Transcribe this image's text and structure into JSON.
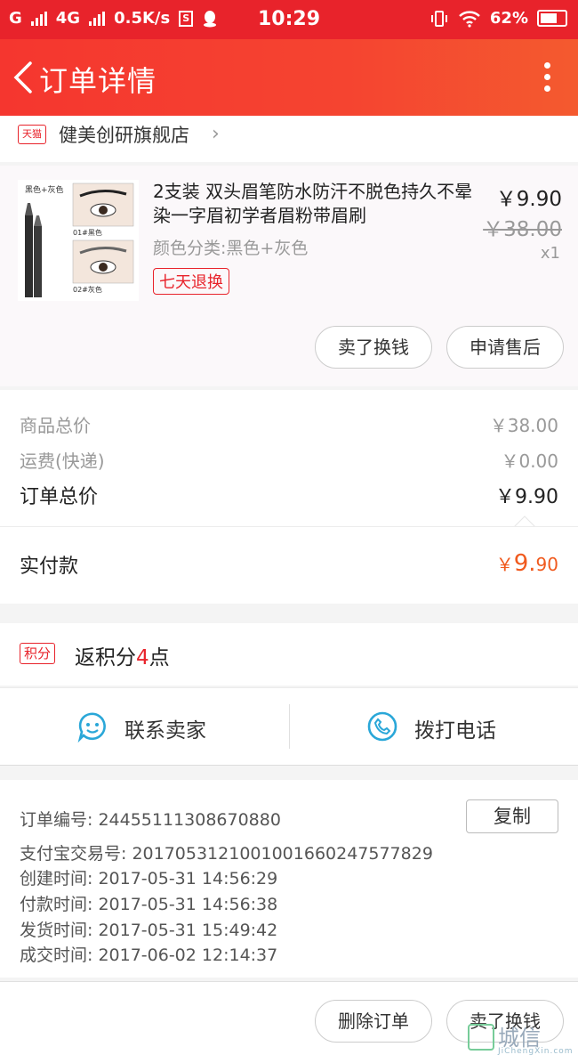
{
  "status_bar": {
    "carrier1": "G",
    "carrier2": "4G",
    "speed": "0.5K/s",
    "s_badge": "S",
    "time": "10:29",
    "battery": "62%"
  },
  "header": {
    "title": "订单详情"
  },
  "shop": {
    "badge": "天猫",
    "name": "健美创研旗舰店"
  },
  "product": {
    "title": "2支装 双头眉笔防水防汗不脱色持久不晕染一字眉初学者眉粉带眉刷",
    "attribute": "颜色分类:黑色+灰色",
    "tag": "七天退换",
    "price": "￥9.90",
    "original_price": "￥38.00",
    "quantity": "x1",
    "thumb_caption": "黑色+灰色",
    "thumb_label_1": "01#黑色",
    "thumb_label_2": "02#灰色"
  },
  "product_actions": {
    "sell": "卖了换钱",
    "after_sale": "申请售后"
  },
  "summary": {
    "goods_total_label": "商品总价",
    "goods_total": "￥38.00",
    "shipping_label": "运费(快递)",
    "shipping": "￥0.00",
    "order_total_label": "订单总价",
    "order_total": "￥9.90",
    "paid_label": "实付款",
    "paid_currency": "￥",
    "paid_int": "9.",
    "paid_dec": "90"
  },
  "points": {
    "badge": "积分",
    "text_before": "返积分",
    "num": "4",
    "text_after": "点"
  },
  "contact": {
    "seller": "联系卖家",
    "phone": "拨打电话"
  },
  "order_info": {
    "order_no": "订单编号:   24455111308670880",
    "copy": "复制",
    "alipay_no": "支付宝交易号:   2017053121001001660247577829",
    "created": "创建时间:   2017-05-31 14:56:29",
    "paid": "付款时间:   2017-05-31 14:56:38",
    "shipped": "发货时间:   2017-05-31 15:49:42",
    "completed": "成交时间:   2017-06-02 12:14:37"
  },
  "bottom_actions": {
    "delete": "删除订单",
    "sell": "卖了换钱"
  },
  "watermark": {
    "text": "城信",
    "sub": "JiChengXin.com"
  },
  "colors": {
    "brand": "#e8232b",
    "price_accent": "#f05a1e"
  }
}
